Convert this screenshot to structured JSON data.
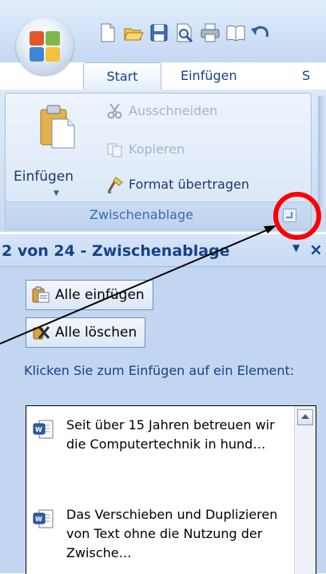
{
  "tabs": {
    "start": "Start",
    "insert": "Einfügen",
    "partial": "S"
  },
  "clipboard_group": {
    "paste_label": "Einfügen",
    "cut_label": "Ausschneiden",
    "copy_label": "Kopieren",
    "format_painter_label": "Format übertragen",
    "group_label": "Zwischenablage"
  },
  "task_pane": {
    "title": "2 von 24 - Zwischenablage",
    "paste_all_label": "Alle einfügen",
    "clear_all_label": "Alle löschen",
    "hint": "Klicken Sie zum Einfügen auf ein Element:",
    "items": [
      "Seit über 15 Jahren betreuen wir die Computertechnik in hund…",
      "Das Verschieben und Duplizieren von Text ohne die Nutzung der Zwische…"
    ]
  },
  "colors": {
    "annotation_circle": "#ff0000",
    "ribbon_text": "#15428b"
  }
}
